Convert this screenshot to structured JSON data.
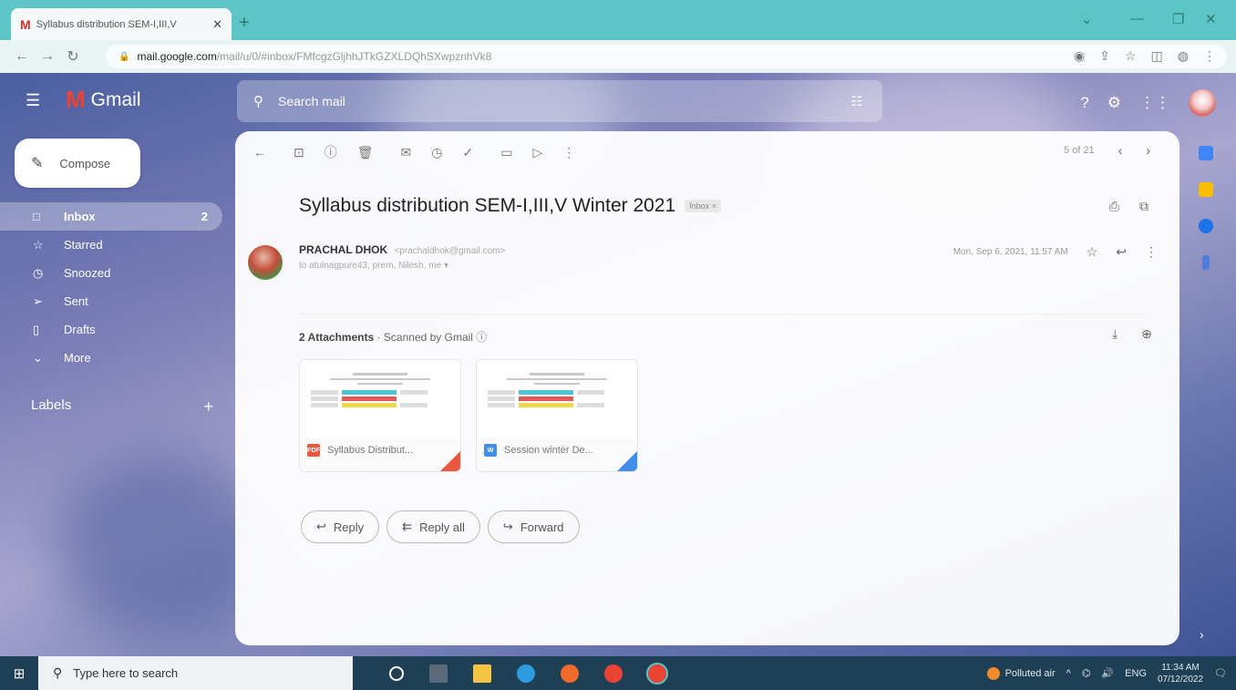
{
  "browser": {
    "tab_title": "Syllabus distribution SEM-I,III,V",
    "tab_favicon": "M",
    "url_host": "mail.google.com",
    "url_path": "/mail/u/0/#inbox/FMfcgzGljhhJTkGZXLDQhSXwpznhVk8"
  },
  "gmail": {
    "logo_letter": "M",
    "logo_text": "Gmail",
    "search_placeholder": "Search mail",
    "compose_label": "Compose",
    "nav": [
      {
        "icon": "□",
        "label": "Inbox",
        "count": "2"
      },
      {
        "icon": "☆",
        "label": "Starred",
        "count": ""
      },
      {
        "icon": "◷",
        "label": "Snoozed",
        "count": ""
      },
      {
        "icon": "➢",
        "label": "Sent",
        "count": ""
      },
      {
        "icon": "▯",
        "label": "Drafts",
        "count": ""
      },
      {
        "icon": "⌄",
        "label": "More",
        "count": ""
      }
    ],
    "labels_title": "Labels",
    "labels_plus": "+"
  },
  "message": {
    "pager": "5 of 21",
    "subject": "Syllabus distribution SEM-I,III,V Winter 2021",
    "badge": "Inbox ×",
    "sender_name": "PRACHAL DHOK",
    "sender_email": "<prachaldhok@gmail.com>",
    "recipients": "to atulnagpure43, prem, Nilesh, me ▾",
    "date": "Mon, Sep 6, 2021, 11:57 AM",
    "attachments_count": "2 Attachments",
    "scanned_text": "· Scanned by Gmail ⓘ",
    "attachments": [
      {
        "name": "Syllabus Distribut...",
        "type_label": "PDF",
        "color": "#e9573f"
      },
      {
        "name": "Session winter De...",
        "type_label": "W",
        "color": "#3f8ee9"
      }
    ],
    "actions": {
      "reply": "Reply",
      "reply_all": "Reply all",
      "forward": "Forward"
    }
  },
  "taskbar": {
    "search_placeholder": "Type here to search",
    "weather": "Polluted air",
    "lang": "ENG",
    "time": "11:34 AM",
    "date": "07/12/2022"
  },
  "colors": {
    "gmail_red": "#ea4335",
    "browser_teal": "#5cc6c6",
    "taskbar": "#1f3f55"
  }
}
